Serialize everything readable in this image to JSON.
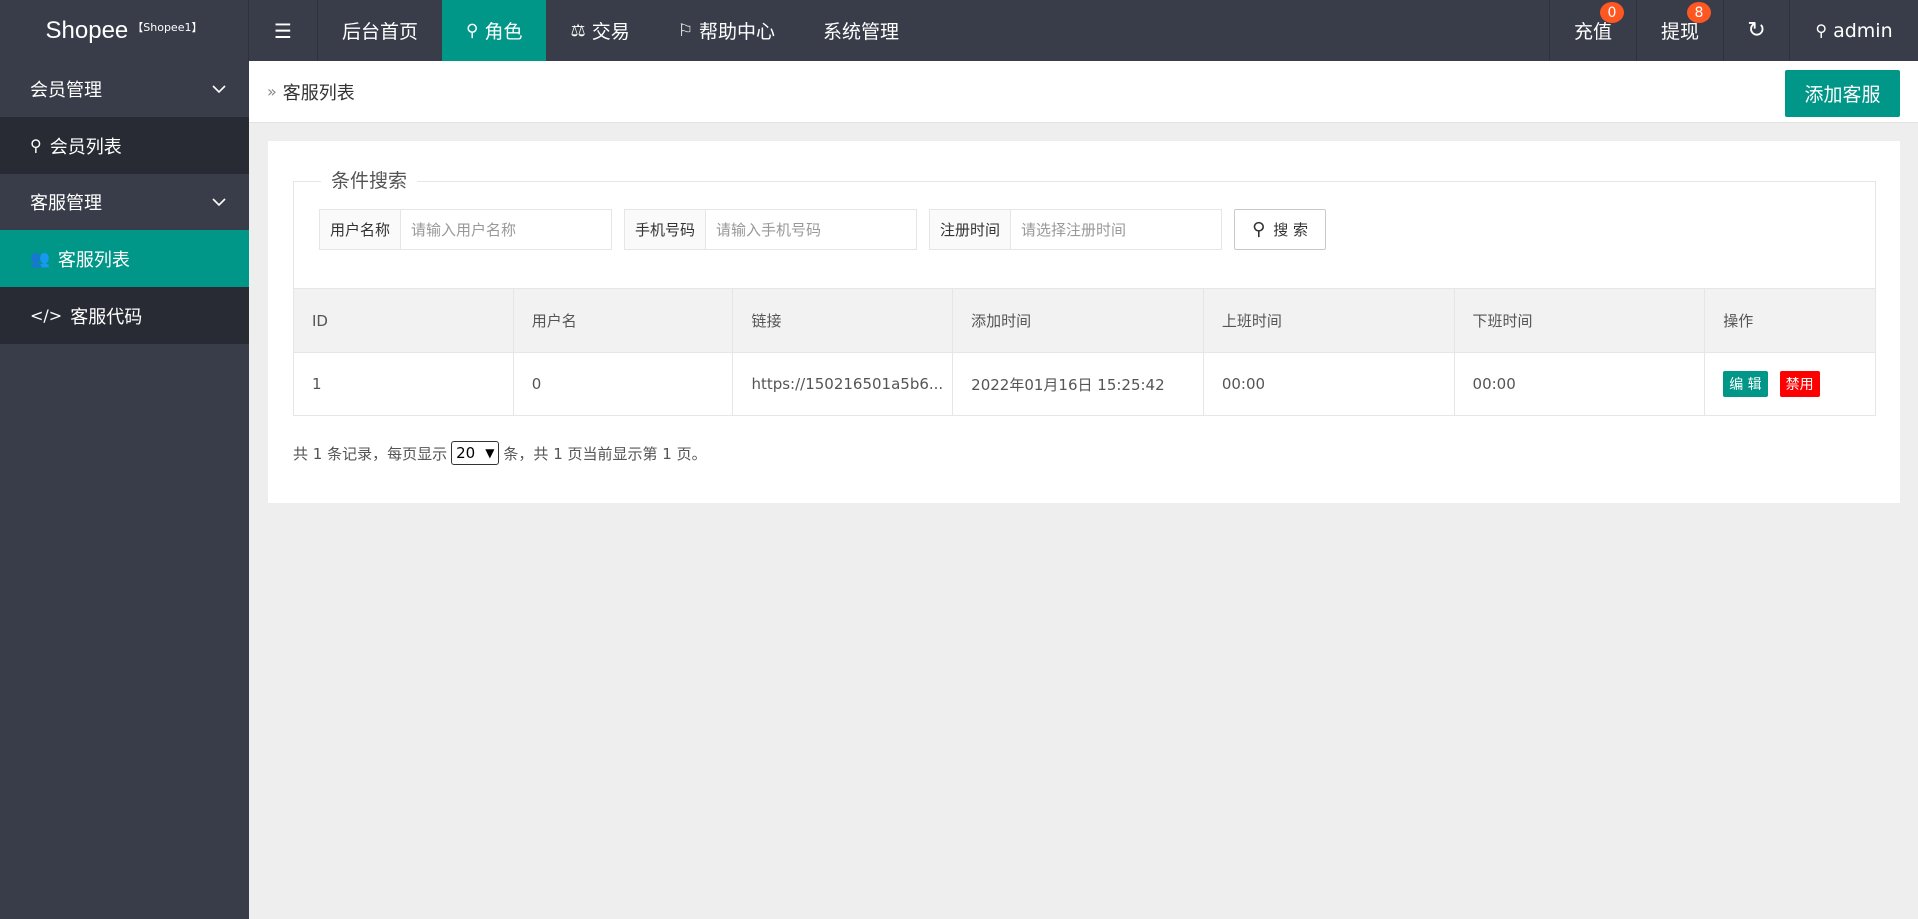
{
  "header": {
    "logo_name": "Shopee",
    "logo_sub": "【Shopee1】",
    "nav": [
      {
        "label": "后台首页"
      },
      {
        "label": "角色"
      },
      {
        "label": "交易"
      },
      {
        "label": "帮助中心"
      },
      {
        "label": "系统管理"
      }
    ],
    "recharge_label": "充值",
    "recharge_badge": "0",
    "withdraw_label": "提现",
    "withdraw_badge": "8",
    "admin_label": "admin"
  },
  "sidebar": {
    "groups": [
      {
        "label": "会员管理",
        "items": [
          {
            "label": "会员列表"
          }
        ]
      },
      {
        "label": "客服管理",
        "items": [
          {
            "label": "客服列表"
          },
          {
            "label": "客服代码"
          }
        ]
      }
    ]
  },
  "breadcrumb": {
    "current": "客服列表"
  },
  "add_button": "添加客服",
  "search": {
    "legend": "条件搜索",
    "fields": [
      {
        "label": "用户名称",
        "placeholder": "请输入用户名称"
      },
      {
        "label": "手机号码",
        "placeholder": "请输入手机号码"
      },
      {
        "label": "注册时间",
        "placeholder": "请选择注册时间"
      }
    ],
    "button": "搜 索"
  },
  "table": {
    "headers": [
      "ID",
      "用户名",
      "链接",
      "添加时间",
      "上班时间",
      "下班时间",
      "操作"
    ],
    "rows": [
      {
        "id": "1",
        "username": "0",
        "link": "https://150216501a5b6...",
        "added": "2022年01月16日 15:25:42",
        "start": "00:00",
        "end": "00:00",
        "edit": "编 辑",
        "disable": "禁用"
      }
    ]
  },
  "pager": {
    "prefix": "共 1 条记录，每页显示",
    "page_size": "20",
    "suffix": "条，共 1 页当前显示第 1 页。"
  },
  "colors": {
    "accent": "#009688",
    "dark": "#393d49",
    "danger": "#ff0000",
    "badge": "#ff5722"
  }
}
